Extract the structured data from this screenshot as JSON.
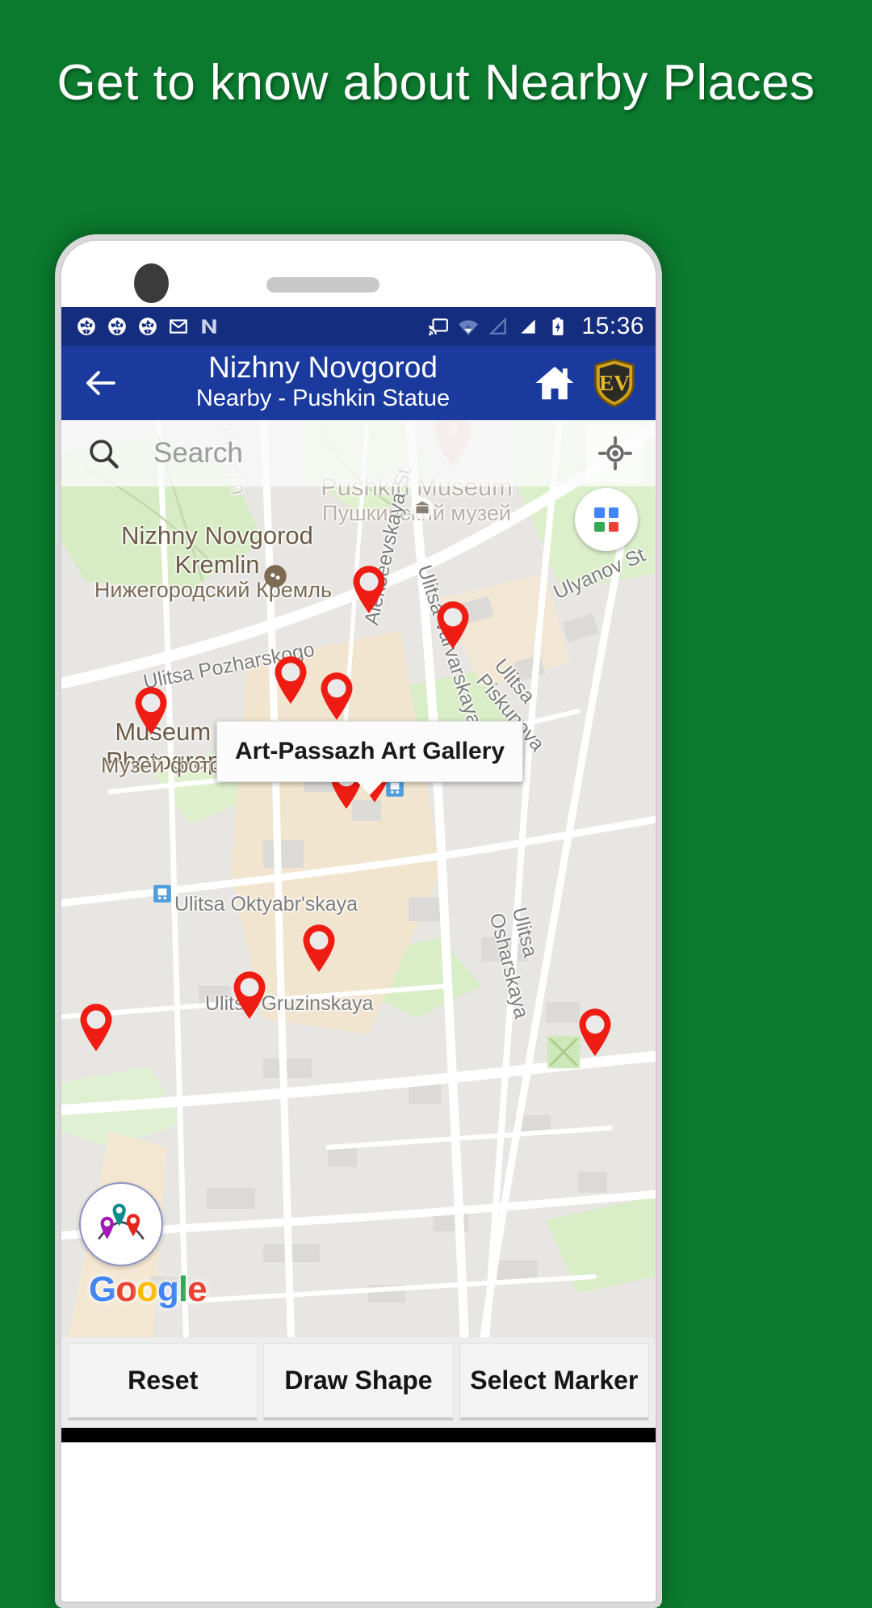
{
  "promo": {
    "headline": "Get to know about Nearby Places",
    "background_color": "#0b7a2e"
  },
  "status_bar": {
    "time": "15:36",
    "left_icons": [
      "camera-aperture-icon",
      "camera-aperture-icon",
      "camera-aperture-icon",
      "gmail-icon",
      "n-app-icon"
    ],
    "right_icons": [
      "cast-icon",
      "wifi-icon",
      "signal-empty-icon",
      "signal-full-icon",
      "battery-charging-icon"
    ],
    "background_color": "#152d7f"
  },
  "app_bar": {
    "back_icon": "arrow-left-icon",
    "title": "Nizhny Novgorod",
    "subtitle": "Nearby - Pushkin Statue",
    "home_icon": "home-icon",
    "brand_icon": "ev-shield-icon",
    "background_color": "#1a3a9e"
  },
  "map": {
    "search": {
      "icon": "search-icon",
      "placeholder": "Search",
      "value": ""
    },
    "locate_icon": "my-location-icon",
    "layers_icon": "map-type-grid-icon",
    "layers_colors": [
      "#4285F4",
      "#EA4335",
      "#34A853",
      "#EA4335"
    ],
    "info_window": {
      "title": "Art-Passazh Art Gallery"
    },
    "attribution": "Google",
    "fab_icon": "nearby-places-pins-icon",
    "labels": [
      {
        "text": "Pushkin Museum",
        "type": "poi-faint"
      },
      {
        "text": "Пушкинский музей",
        "type": "poi-faint"
      },
      {
        "text": "Nizhny Novgorod Kremlin",
        "type": "poi"
      },
      {
        "text": "Нижегородский Кремль",
        "type": "poi2"
      },
      {
        "text": "Museum of Photography",
        "type": "poi"
      },
      {
        "text": "Музей фотографии",
        "type": "poi2"
      },
      {
        "text": "Ulitsa Pozharskogo",
        "type": "street"
      },
      {
        "text": "Alekseevskaya St",
        "type": "street"
      },
      {
        "text": "Ulitsa Varvarskaya",
        "type": "street"
      },
      {
        "text": "Ulyanov St",
        "type": "street"
      },
      {
        "text": "Ulitsa Piskunova",
        "type": "street"
      },
      {
        "text": "Ulitsa Oktyabr'skaya",
        "type": "street"
      },
      {
        "text": "Ulitsa Gruzinskaya",
        "type": "street"
      },
      {
        "text": "Ulitsa Osharskaya",
        "type": "street"
      },
      {
        "text": "Kremlin",
        "type": "street"
      }
    ],
    "cluster_badge": "2",
    "marker_count": 13
  },
  "bottom_actions": [
    {
      "label": "Reset"
    },
    {
      "label": "Draw Shape"
    },
    {
      "label": "Select Marker"
    }
  ]
}
